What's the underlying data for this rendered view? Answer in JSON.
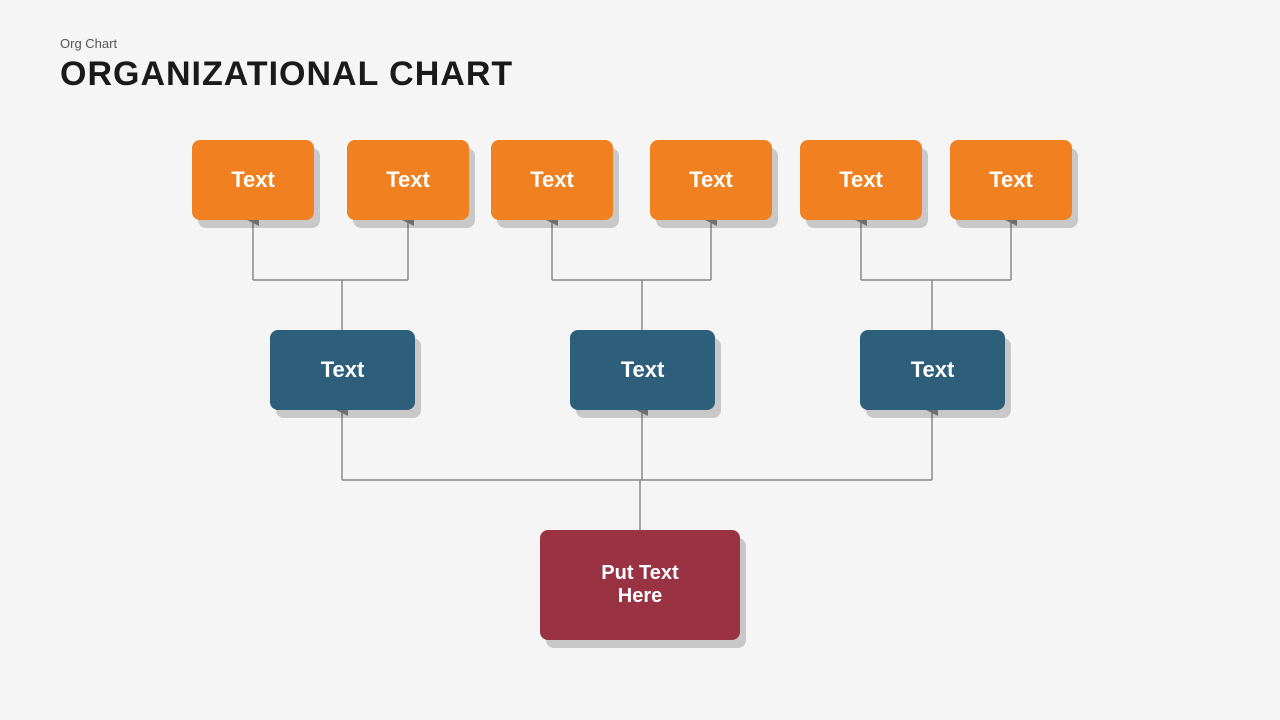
{
  "header": {
    "subtitle": "Org  Chart",
    "title": "ORGANIZATIONAL CHART"
  },
  "colors": {
    "orange": "#F08020",
    "blue": "#2E5F7A",
    "red": "#993344",
    "line": "#888888"
  },
  "boxes": {
    "orange": [
      "Text",
      "Text",
      "Text",
      "Text",
      "Text",
      "Text"
    ],
    "blue": [
      "Text",
      "Text",
      "Text"
    ],
    "root": "Put Text\nHere"
  }
}
